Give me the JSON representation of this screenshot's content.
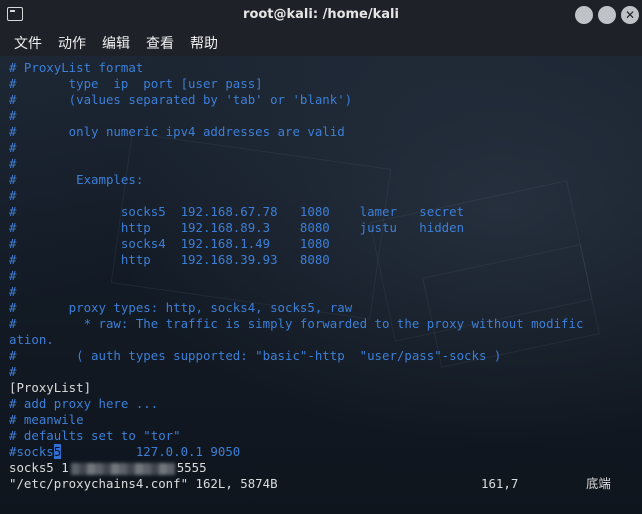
{
  "window": {
    "title": "root@kali: /home/kali"
  },
  "menu": {
    "items": [
      "文件",
      "动作",
      "编辑",
      "查看",
      "帮助"
    ]
  },
  "editor": {
    "lines": [
      "# ProxyList format",
      "#       type  ip  port [user pass]",
      "#       (values separated by 'tab' or 'blank')",
      "#",
      "#       only numeric ipv4 addresses are valid",
      "#",
      "#",
      "#        Examples:",
      "#",
      "#              socks5  192.168.67.78   1080    lamer   secret",
      "#              http    192.168.89.3    8080    justu   hidden",
      "#              socks4  192.168.1.49    1080",
      "#              http    192.168.39.93   8080",
      "#",
      "#",
      "#       proxy types: http, socks4, socks5, raw",
      "#         * raw: The traffic is simply forwarded to the proxy without modific",
      "ation.",
      "#        ( auth types supported: \"basic\"-http  \"user/pass\"-socks )",
      "#",
      "[ProxyList]",
      "# add proxy here ...",
      "# meanwile",
      "# defaults set to \"tor\""
    ],
    "commented_entry": {
      "prefix": "#socks",
      "cursor_char": "5",
      "rest": "          127.0.0.1 9050"
    },
    "active_entry": {
      "prefix": "socks5 1",
      "suffix": "5555"
    },
    "status": {
      "file_info": "\"/etc/proxychains4.conf\" 162L, 5874B",
      "position": "161,7",
      "scroll": "底端"
    }
  }
}
